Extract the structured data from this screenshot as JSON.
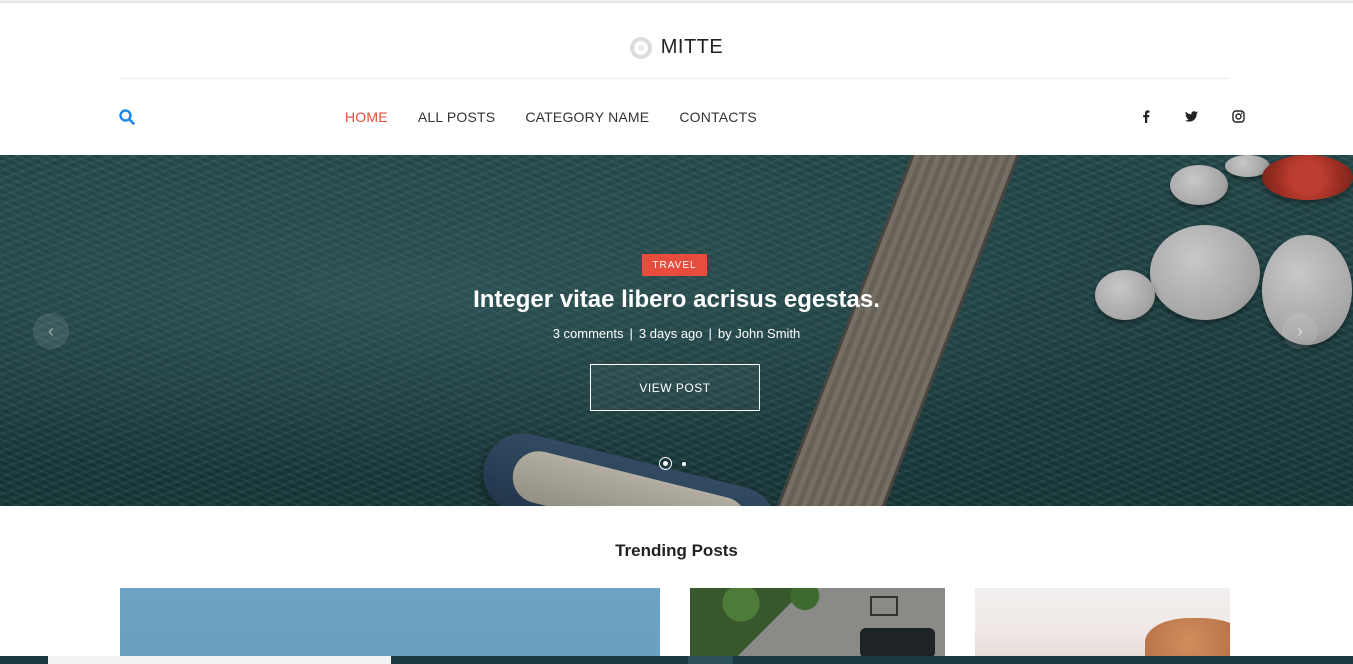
{
  "site": {
    "brand_name": "MITTE"
  },
  "nav": {
    "items": [
      {
        "label": "HOME",
        "active": true
      },
      {
        "label": "ALL POSTS",
        "active": false
      },
      {
        "label": "CATEGORY NAME",
        "active": false
      },
      {
        "label": "CONTACTS",
        "active": false
      }
    ]
  },
  "social": [
    "facebook-icon",
    "twitter-icon",
    "instagram-icon"
  ],
  "hero": {
    "category": "TRAVEL",
    "title": "Integer vitae libero acrisus egestas.",
    "comments": "3 comments",
    "date": "3 days ago",
    "author": "by John Smith",
    "button_label": "VIEW POST",
    "arrow_prev": "‹",
    "arrow_next": "›"
  },
  "trending": {
    "title": "Trending Posts"
  },
  "colors": {
    "accent": "#e74c3c",
    "search": "#1e88e5",
    "taskbar": "#1d3a44"
  }
}
